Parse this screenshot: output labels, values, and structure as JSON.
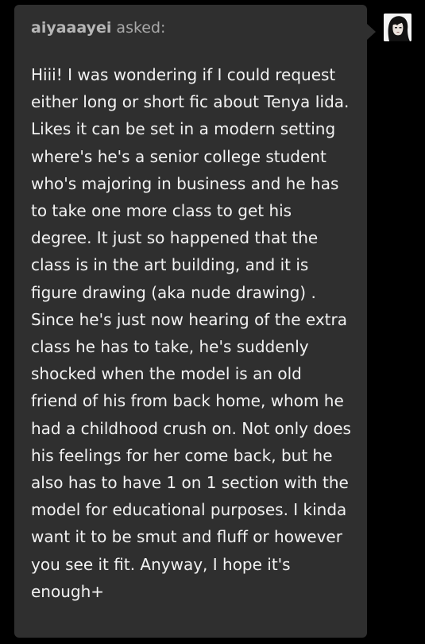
{
  "ask": {
    "asker_name": "aiyaaayei",
    "asker_suffix": " asked:",
    "question": "Hiii! I was wondering if I could request either long or short fic about Tenya Iida. Likes it can be set in a modern setting where's he's a senior college student who's majoring in business and he has to take one more class to get his degree. It just so happened that the class is in the art building, and it is figure drawing (aka nude drawing) . Since he's just now hearing of the extra class he has to take, he's suddenly shocked when the model is an old friend of his from back home, whom he had a childhood crush on. Not only does his feelings for her come back, but he also has to have 1 on 1 section with the model for educational purposes. I kinda want it to be smut and fluff or however you see it fit. Anyway, I hope it's enough+"
  },
  "colors": {
    "page_background": "#000000",
    "bubble_background": "#2f2f2f",
    "asker_text": "#a9a9a9",
    "body_text": "#f2f2f2"
  },
  "avatar": {
    "icon": "user-avatar-icon"
  }
}
